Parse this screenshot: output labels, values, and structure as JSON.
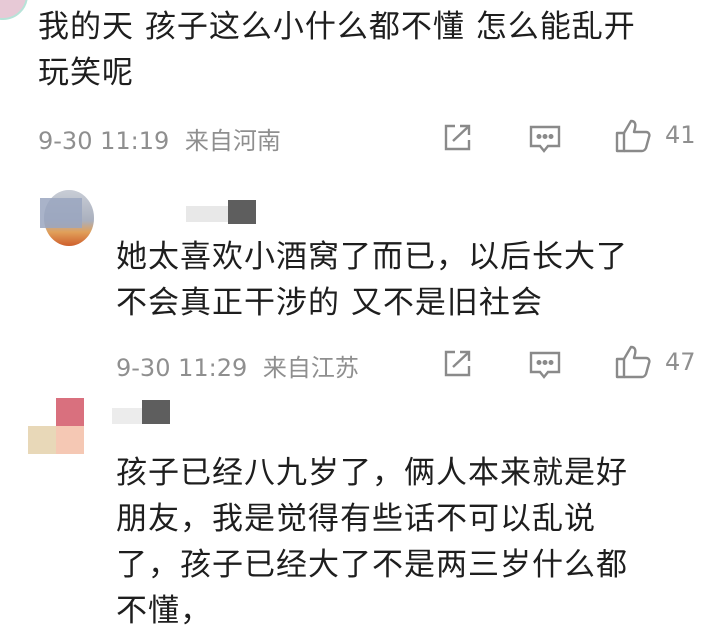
{
  "comments": [
    {
      "text_lines": [
        "我的天 孩子这么小什么都不懂 怎么能乱开",
        "玩笑呢"
      ],
      "time": "9-30 11:19",
      "location": "来自河南",
      "likes": "41"
    },
    {
      "text_lines": [
        "她太喜欢小酒窝了而已，以后长大了",
        "不会真正干涉的 又不是旧社会"
      ],
      "time": "9-30 11:29",
      "location": "来自江苏",
      "likes": "47"
    },
    {
      "text_lines": [
        "孩子已经八九岁了，俩人本来就是好",
        "朋友，我是觉得有些话不可以乱说",
        "了，孩子已经大了不是两三岁什么都",
        "不懂，"
      ]
    }
  ],
  "icons": {
    "share": "share-icon",
    "reply": "comment-icon",
    "like": "thumbs-up-icon"
  },
  "colors": {
    "text": "#1e1e1e",
    "meta": "#8f8f8f",
    "icon": "#8a8a8a"
  }
}
